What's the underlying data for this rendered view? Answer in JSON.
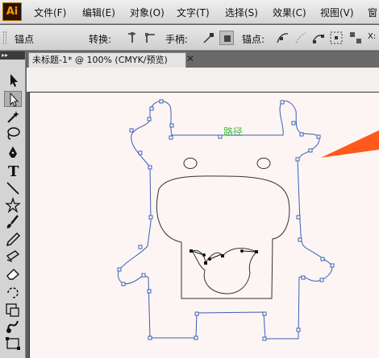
{
  "app": {
    "logo": "Ai"
  },
  "menu": {
    "items": [
      "文件(F)",
      "编辑(E)",
      "对象(O)",
      "文字(T)",
      "选择(S)",
      "效果(C)",
      "视图(V)",
      "窗"
    ]
  },
  "control_bar": {
    "anchor_label": "锚点",
    "convert_label": "转换:",
    "handles_label": "手柄:",
    "anchors_label": "锚点:",
    "overflow_label": "X:"
  },
  "document": {
    "tab_title": "未标题-1* @ 100% (CMYK/预览)",
    "close_glyph": "✕"
  },
  "canvas": {
    "path_label": "路径"
  },
  "tools": [
    "selection-tool",
    "direct-selection-tool",
    "magic-wand-tool",
    "lasso-tool",
    "pen-tool",
    "type-tool",
    "line-tool",
    "rectangle-tool",
    "paintbrush-tool",
    "pencil-tool",
    "blob-brush-tool",
    "eraser-tool",
    "rotate-tool",
    "scale-tool",
    "warp-tool",
    "free-transform-tool"
  ],
  "colors": {
    "path_stroke": "#3b5fb5",
    "label_green": "#3ec03e",
    "arrow_orange": "#ff5a1c",
    "artboard": "#fcf5f3"
  }
}
